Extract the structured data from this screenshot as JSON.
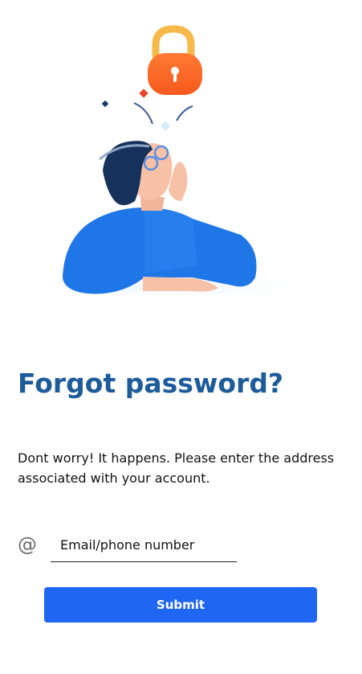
{
  "header": {
    "title": "Forgot password?",
    "subtitle": "Dont worry! It happens. Please enter the address associated with your account."
  },
  "form": {
    "email_placeholder": "Email/phone number",
    "email_value": "",
    "at_icon": "@",
    "submit_label": "Submit"
  },
  "colors": {
    "title": "#1d5b9b",
    "button": "#1f66f2",
    "shirt": "#1f76e6",
    "lock_body": "#ff6a2a",
    "lock_shackle": "#f6b94a"
  }
}
